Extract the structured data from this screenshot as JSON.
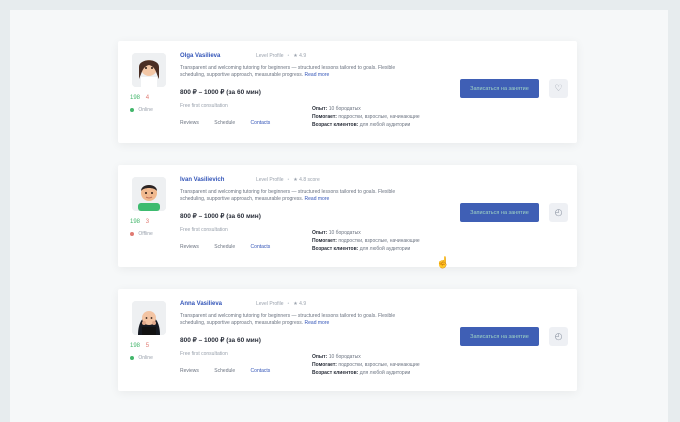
{
  "results": [
    {
      "name": "Olga Vasilieva",
      "meta1": "Level Profile",
      "meta2": "★ 4.9",
      "description": "Transparent and welcoming tutoring for beginners — structured lessons tailored to goals. Flexible scheduling, supportive approach, measurable progress.",
      "more": "Read more",
      "price": "800 ₽ – 1000 ₽ (за 60 мин)",
      "small_text": "Free first consultation",
      "links": [
        "Reviews",
        "Schedule",
        "Contacts"
      ],
      "facts": [
        {
          "label": "Опыт:",
          "value": "10 бородатых"
        },
        {
          "label": "Помогает:",
          "value": "подростки, взрослые, начинающие"
        },
        {
          "label": "Возраст клиентов:",
          "value": "для любой аудитории"
        }
      ],
      "likes": "198",
      "dislikes": "4",
      "status": "Online",
      "status_color": "#43b66b",
      "cta": "Записаться на занятие",
      "fav_icon": "heart-icon"
    },
    {
      "name": "Ivan Vasilievich",
      "meta1": "Level Profile",
      "meta2": "★ 4.8 score",
      "description": "Transparent and welcoming tutoring for beginners — structured lessons tailored to goals. Flexible scheduling, supportive approach, measurable progress.",
      "more": "Read more",
      "price": "800 ₽ – 1000 ₽ (за 60 мин)",
      "small_text": "Free first consultation",
      "links": [
        "Reviews",
        "Schedule",
        "Contacts"
      ],
      "facts": [
        {
          "label": "Опыт:",
          "value": "10 бородатых"
        },
        {
          "label": "Помогает:",
          "value": "подростки, взрослые, начинающие"
        },
        {
          "label": "Возраст клиентов:",
          "value": "для любой аудитории"
        }
      ],
      "likes": "198",
      "dislikes": "3",
      "status": "Offline",
      "status_color": "#e07a72",
      "cta": "Записаться на занятие",
      "fav_icon": "clock-icon"
    },
    {
      "name": "Anna Vasilieva",
      "meta1": "Level Profile",
      "meta2": "★ 4.9",
      "description": "Transparent and welcoming tutoring for beginners — structured lessons tailored to goals. Flexible scheduling, supportive approach, measurable progress.",
      "more": "Read more",
      "price": "800 ₽ – 1000 ₽ (за 60 мин)",
      "small_text": "Free first consultation",
      "links": [
        "Reviews",
        "Schedule",
        "Contacts"
      ],
      "facts": [
        {
          "label": "Опыт:",
          "value": "10 бородатых"
        },
        {
          "label": "Помогает:",
          "value": "подростки, взрослые, начинающие"
        },
        {
          "label": "Возраст клиентов:",
          "value": "для любой аудитории"
        }
      ],
      "likes": "198",
      "dislikes": "5",
      "status": "Online",
      "status_color": "#43b66b",
      "cta": "Записаться на занятие",
      "fav_icon": "clock-icon"
    }
  ],
  "cursor_icon": "hand-pointer-icon"
}
